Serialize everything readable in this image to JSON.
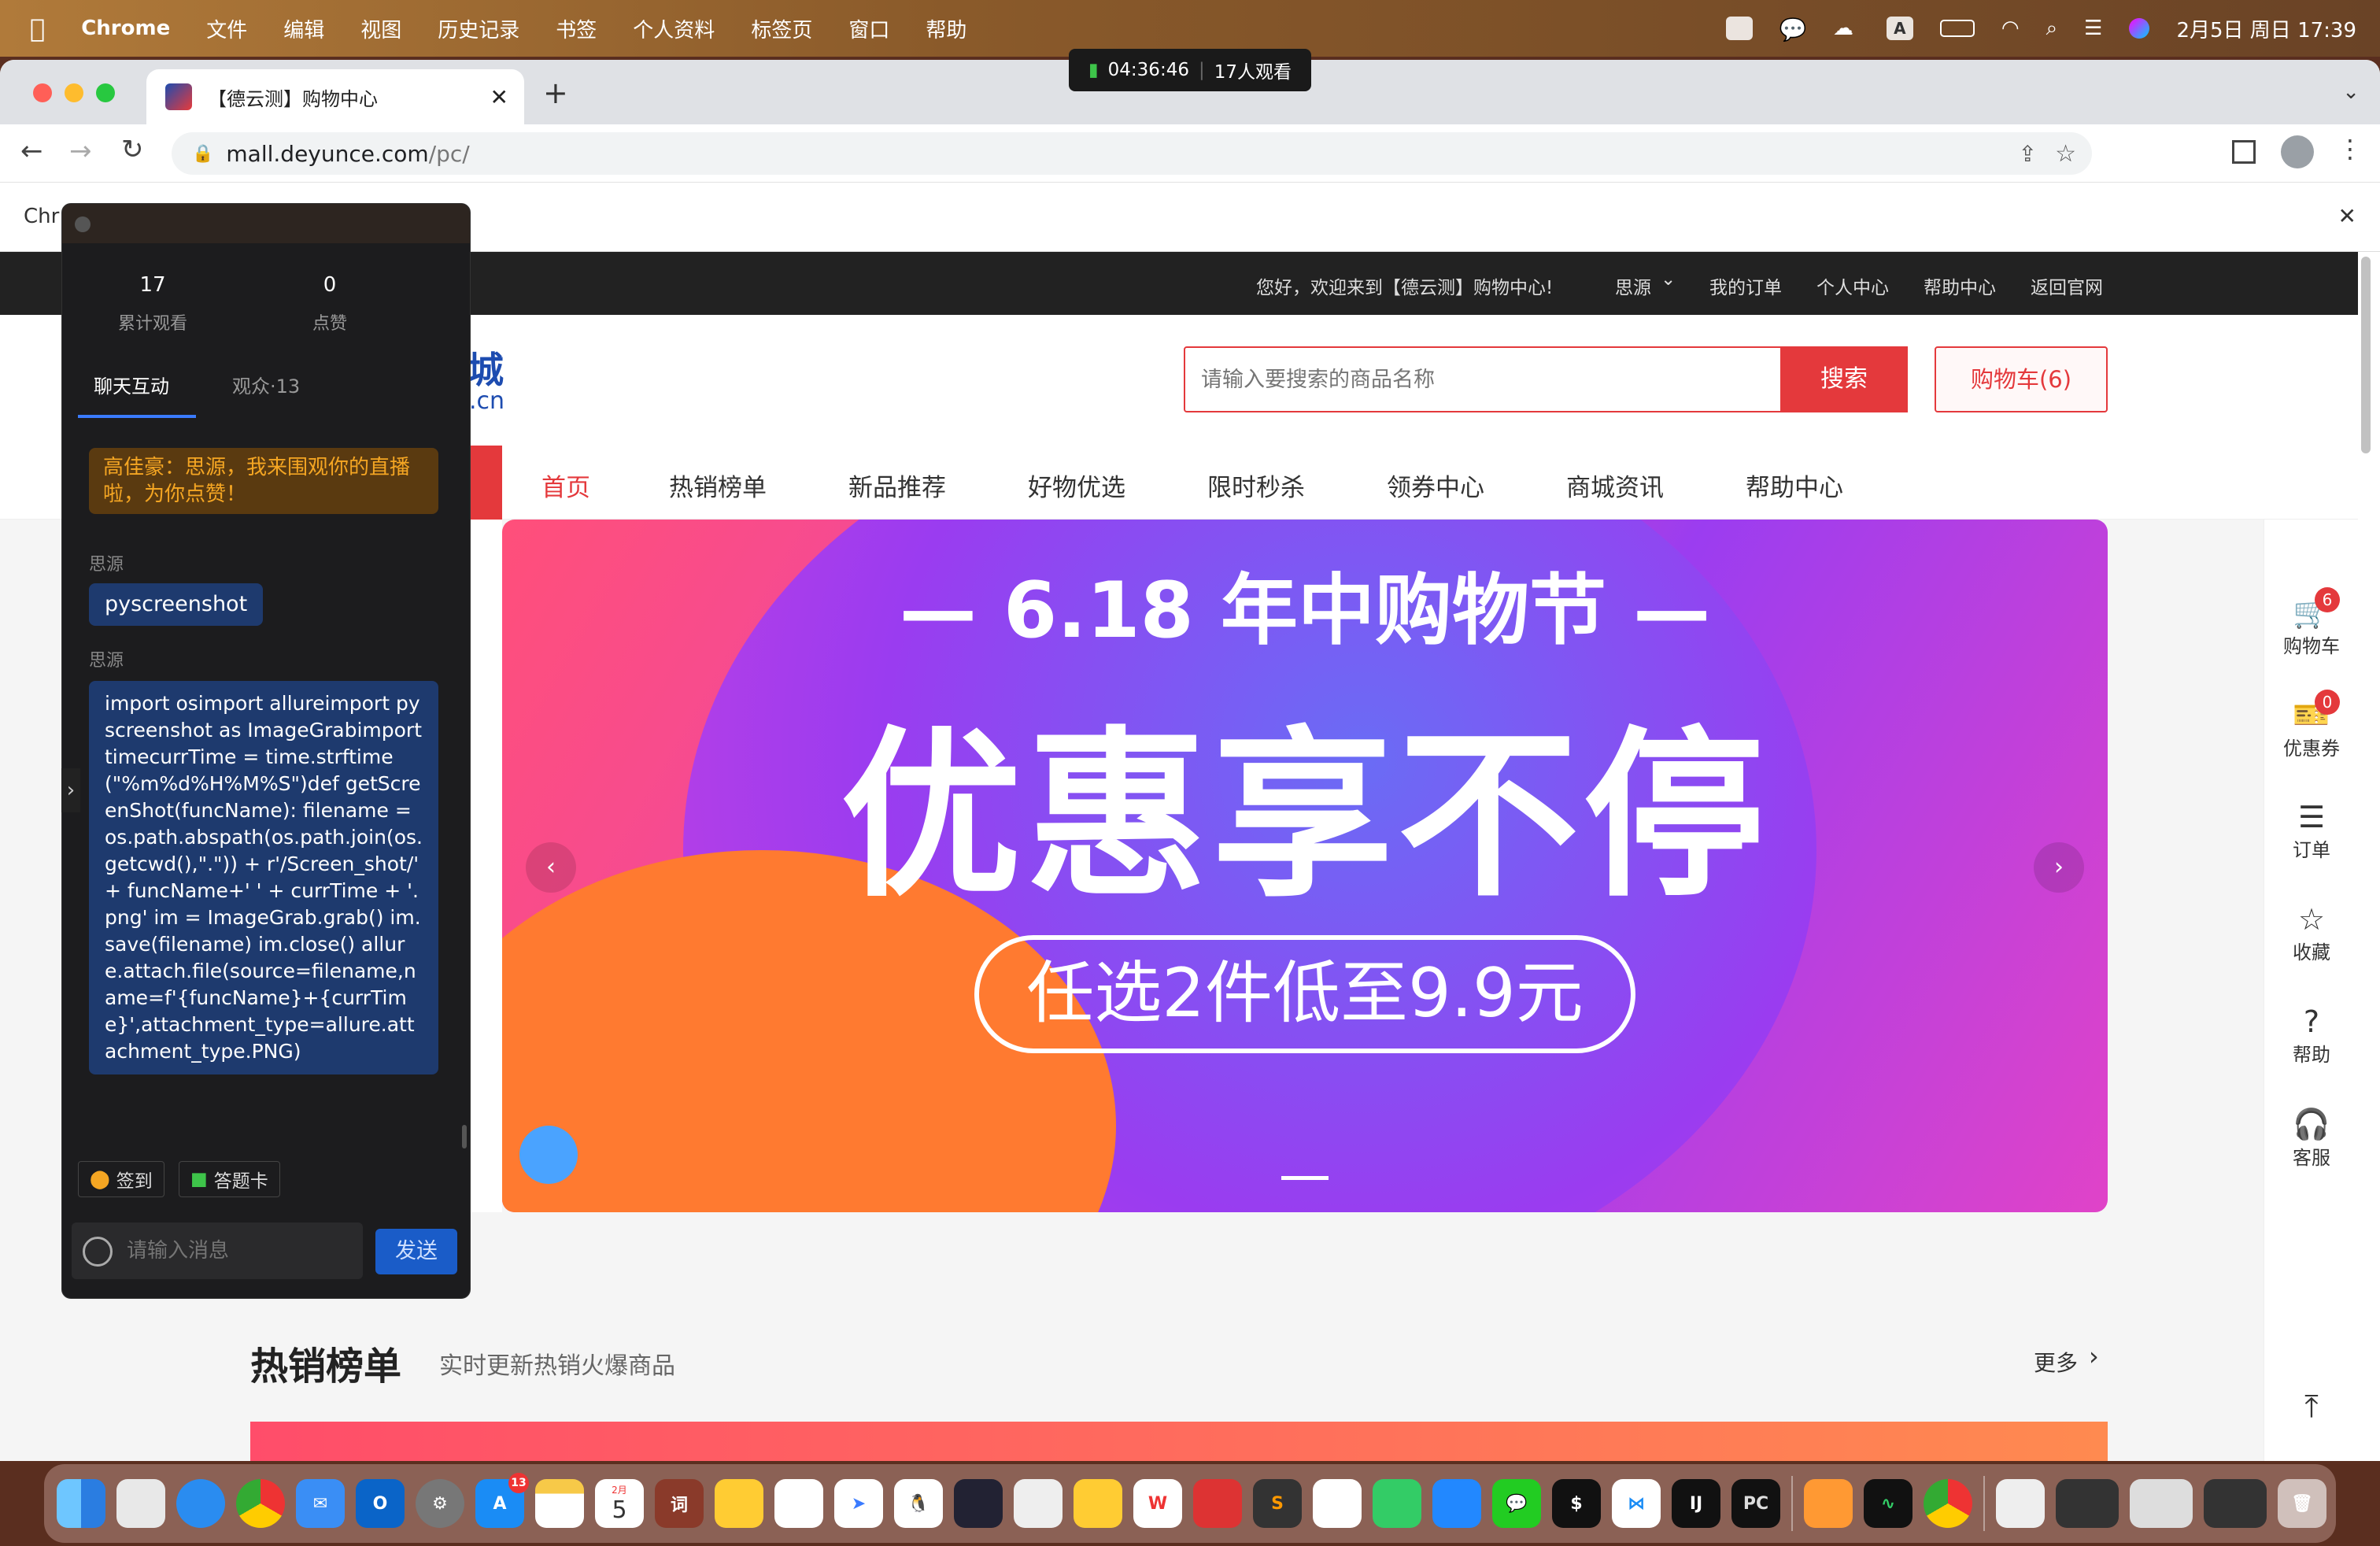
{
  "menubar": {
    "app": "Chrome",
    "items": [
      "文件",
      "编辑",
      "视图",
      "历史记录",
      "书签",
      "个人资料",
      "标签页",
      "窗口",
      "帮助"
    ],
    "datetime": "2月5日 周日  17:39",
    "input_badge": "A"
  },
  "live_pill": {
    "time": "04:36:46",
    "viewers": "17人观看"
  },
  "browser": {
    "tab_title": "【德云测】购物中心",
    "url_host": "mall.deyunce.com",
    "url_path": "/pc/",
    "infobar_text": "Chr"
  },
  "site": {
    "topbar": {
      "welcome": "您好，欢迎来到【德云测】购物中心!",
      "user": "思源",
      "links": [
        "我的订单",
        "个人中心",
        "帮助中心",
        "返回官网"
      ]
    },
    "logo_fragment": "城",
    "logo_domain": ".cn",
    "search": {
      "placeholder": "请输入要搜索的商品名称",
      "button": "搜索"
    },
    "cart_button": "购物车(6)",
    "nav": [
      "首页",
      "热销榜单",
      "新品推荐",
      "好物优选",
      "限时秒杀",
      "领券中心",
      "商城资讯",
      "帮助中心"
    ],
    "banner": {
      "line1": "— 6.18 年中购物节 —",
      "line2": "优惠享不停",
      "line3": "任选2件低至9.9元"
    },
    "section": {
      "title": "热销榜单",
      "subtitle": "实时更新热销火爆商品",
      "more": "更多"
    },
    "rightbar": [
      {
        "label": "购物车",
        "icon": "cart-icon",
        "badge": "6"
      },
      {
        "label": "优惠券",
        "icon": "coupon-icon",
        "badge": "0"
      },
      {
        "label": "订单",
        "icon": "order-icon"
      },
      {
        "label": "收藏",
        "icon": "star-icon"
      },
      {
        "label": "帮助",
        "icon": "help-icon"
      },
      {
        "label": "客服",
        "icon": "headset-icon"
      }
    ]
  },
  "chat": {
    "stats": [
      {
        "value": "17",
        "label": "累计观看"
      },
      {
        "value": "0",
        "label": "点赞"
      }
    ],
    "tabs": [
      "聊天互动",
      "观众·13"
    ],
    "notice": "高佳豪：思源，我来围观你的直播啦，为你点赞！",
    "msg1_sender": "思源",
    "msg1": "pyscreenshot",
    "msg2_sender": "思源",
    "msg2": "import osimport allureimport pyscreenshot as ImageGrabimport timecurrTime = time.strftime(\"%m%d%H%M%S\")def getScreenShot(funcName):    filename = os.path.abspath(os.path.join(os.getcwd(),\".\")) + r'/Screen_shot/' + funcName+' ' + currTime + '.png'    im = ImageGrab.grab()    im.save(filename)    im.close()    allure.attach.file(source=filename,name=f'{funcName}+{currTime}',attachment_type=allure.attachment_type.PNG)",
    "actions": [
      "签到",
      "答题卡"
    ],
    "input_placeholder": "请输入消息",
    "send": "发送"
  },
  "dock": {
    "calendar_month": "2月",
    "calendar_day": "5",
    "appstore_badge": "13",
    "apps": [
      "finder",
      "launchpad",
      "safari",
      "chrome",
      "mail",
      "outlook",
      "settings",
      "appstore",
      "notes",
      "calendar",
      "dict",
      "app1",
      "app2",
      "feishu",
      "qq",
      "app3",
      "app4",
      "app5",
      "wps",
      "app6",
      "sublime",
      "app7",
      "app8",
      "app9",
      "wechat",
      "terminal",
      "vscode",
      "intellij",
      "pycharm",
      "app10",
      "monitor",
      "chrome2",
      "doc1",
      "doc2",
      "doc3",
      "doc4",
      "trash"
    ]
  },
  "colors": {
    "accent": "#e4393c",
    "topbar": "#222222",
    "chat_bg": "#1c1c1e",
    "bubble_blue": "#1e3a6e",
    "notice": "#5a3a10"
  }
}
